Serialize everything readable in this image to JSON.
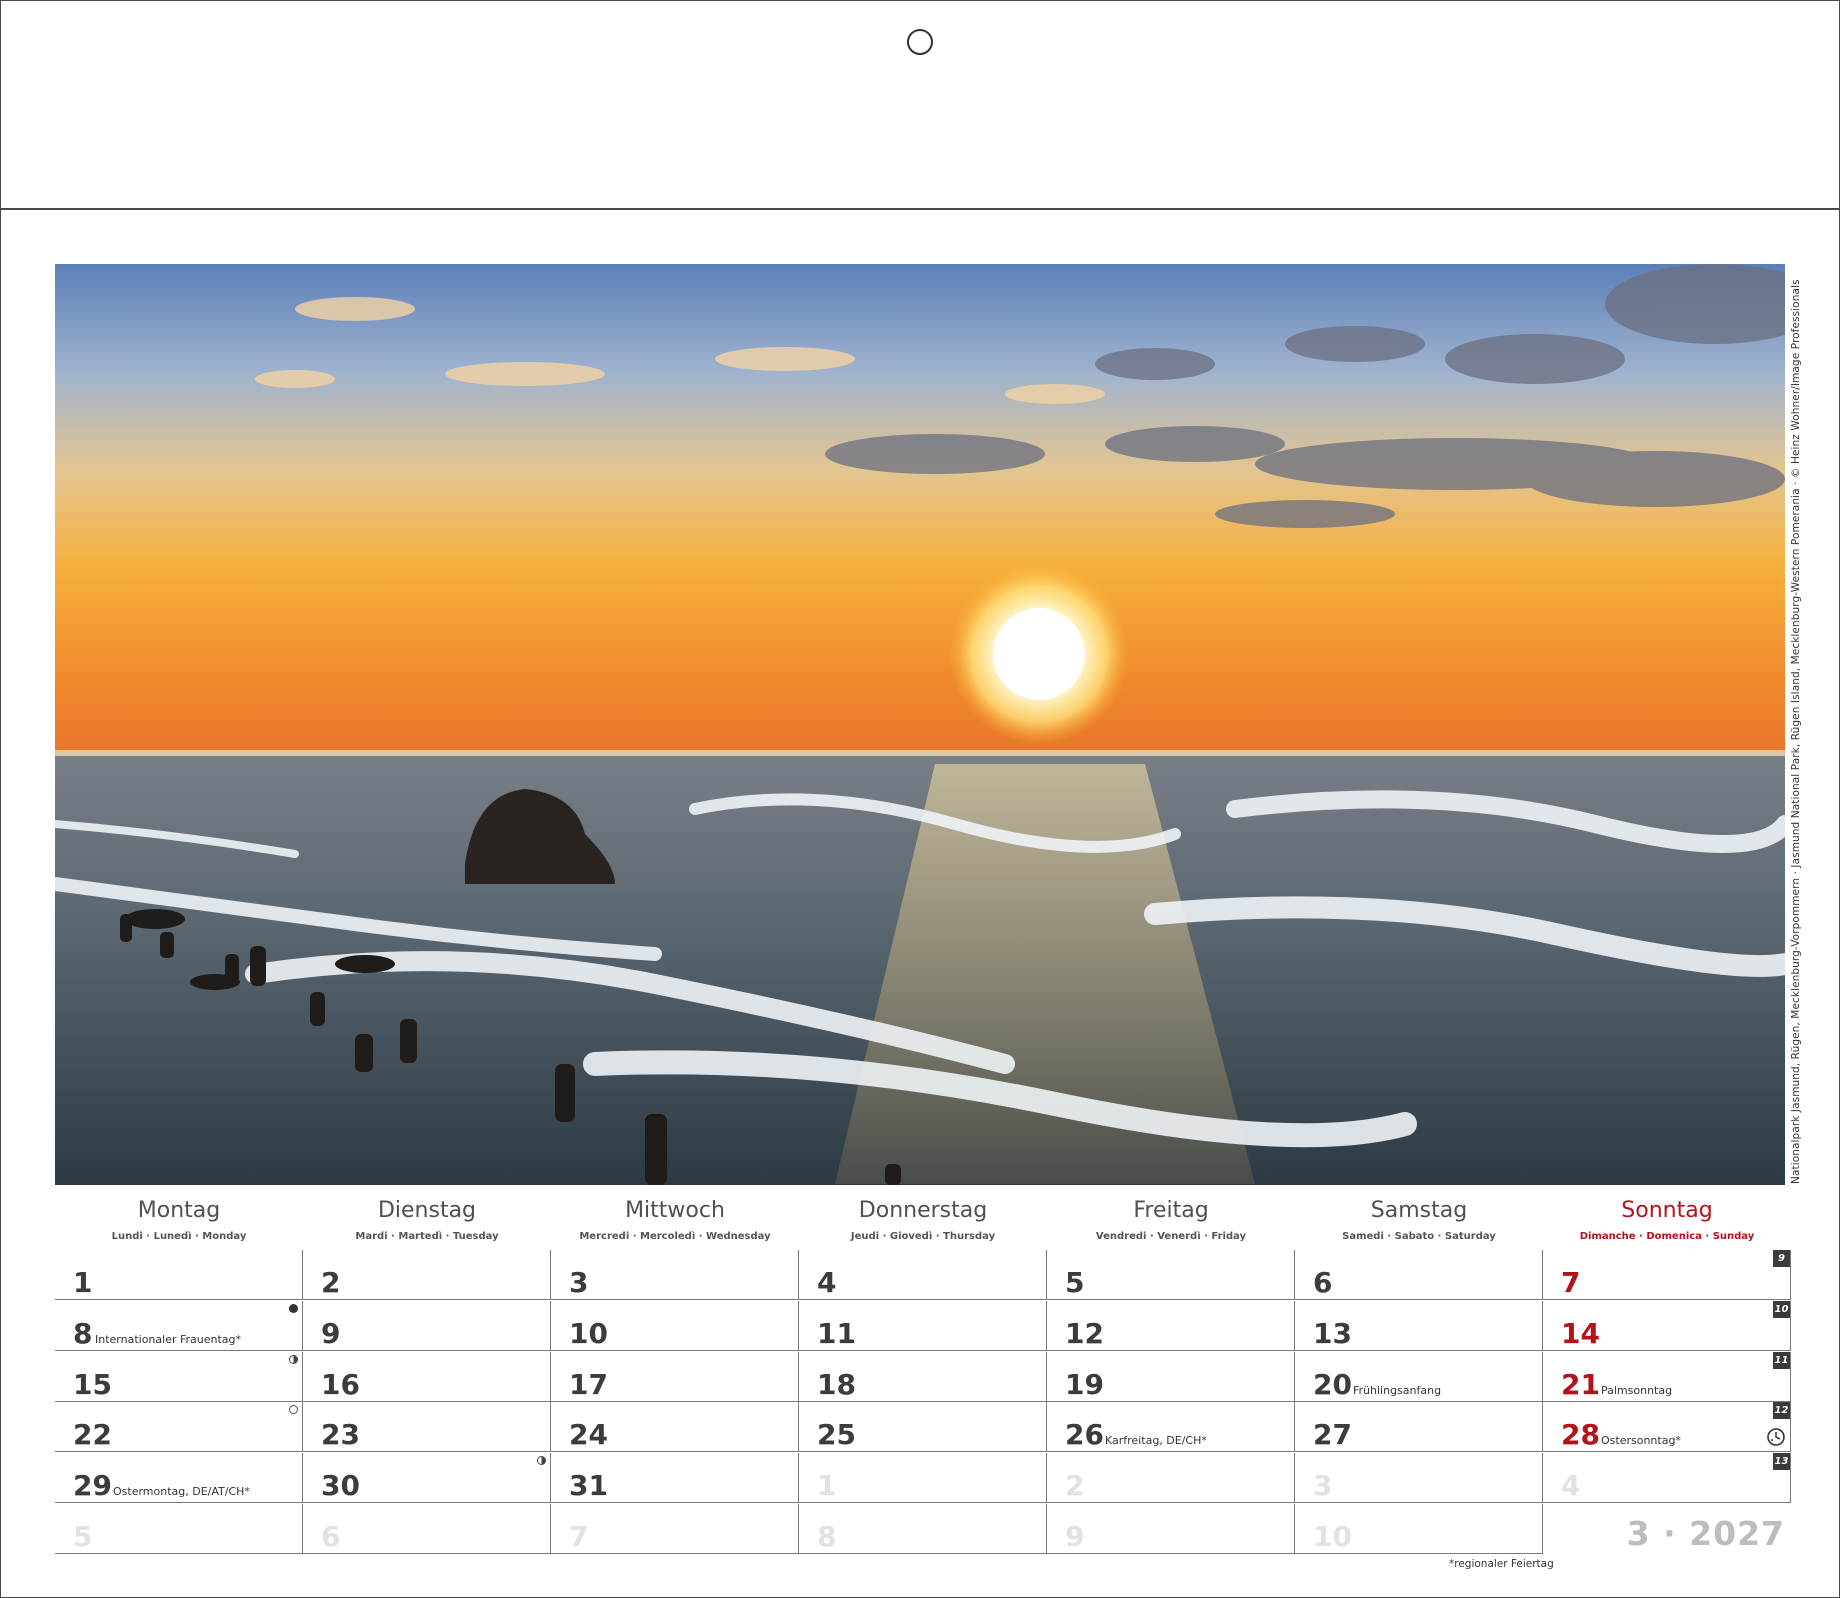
{
  "photo_credit": "Nationalpark Jasmund, Rügen, Mecklenburg-Vorpommern · Jasmund National Park, Rügen Island, Mecklenburg-Western Pomerania · © Heinz Wohner/Image Professionals",
  "weekdays": [
    {
      "name": "Montag",
      "sub": "Lundi · Lunedì · Monday"
    },
    {
      "name": "Dienstag",
      "sub": "Mardi · Martedì · Tuesday"
    },
    {
      "name": "Mittwoch",
      "sub": "Mercredi · Mercoledì · Wednesday"
    },
    {
      "name": "Donnerstag",
      "sub": "Jeudi · Giovedì · Thursday"
    },
    {
      "name": "Freitag",
      "sub": "Vendredi · Venerdì · Friday"
    },
    {
      "name": "Samstag",
      "sub": "Samedi · Sabato · Saturday"
    },
    {
      "name": "Sonntag",
      "sub": "Dimanche · Domenica · Sunday"
    }
  ],
  "weeks": [
    {
      "week_no": "9",
      "days": [
        {
          "n": "1"
        },
        {
          "n": "2"
        },
        {
          "n": "3"
        },
        {
          "n": "4"
        },
        {
          "n": "5"
        },
        {
          "n": "6"
        },
        {
          "n": "7"
        }
      ]
    },
    {
      "week_no": "10",
      "days": [
        {
          "n": "8",
          "note": "Internationaler Frauentag*",
          "moon": "new"
        },
        {
          "n": "9"
        },
        {
          "n": "10"
        },
        {
          "n": "11"
        },
        {
          "n": "12"
        },
        {
          "n": "13"
        },
        {
          "n": "14"
        }
      ]
    },
    {
      "week_no": "11",
      "days": [
        {
          "n": "15",
          "moon": "half"
        },
        {
          "n": "16"
        },
        {
          "n": "17"
        },
        {
          "n": "18"
        },
        {
          "n": "19"
        },
        {
          "n": "20",
          "note": "Frühlingsanfang"
        },
        {
          "n": "21",
          "note": "Palmsonntag"
        }
      ]
    },
    {
      "week_no": "12",
      "days": [
        {
          "n": "22",
          "moon": "full"
        },
        {
          "n": "23"
        },
        {
          "n": "24"
        },
        {
          "n": "25"
        },
        {
          "n": "26",
          "note": "Karfreitag, DE/CH*"
        },
        {
          "n": "27"
        },
        {
          "n": "28",
          "note": "Ostersonntag*",
          "icon": "daylight-saving-clock"
        }
      ]
    },
    {
      "week_no": "13",
      "days": [
        {
          "n": "29",
          "note": "Ostermontag, DE/AT/CH*"
        },
        {
          "n": "30",
          "moon": "half"
        },
        {
          "n": "31"
        },
        {
          "n": "1",
          "dim": true
        },
        {
          "n": "2",
          "dim": true
        },
        {
          "n": "3",
          "dim": true
        },
        {
          "n": "4",
          "dim": true
        }
      ]
    },
    {
      "days": [
        {
          "n": "5",
          "dim": true
        },
        {
          "n": "6",
          "dim": true
        },
        {
          "n": "7",
          "dim": true
        },
        {
          "n": "8",
          "dim": true
        },
        {
          "n": "9",
          "dim": true
        },
        {
          "n": "10",
          "dim": true
        }
      ]
    }
  ],
  "footnote": "*regionaler Feiertag",
  "month_year": "3 · 2027",
  "colors": {
    "sunday_red": "#b3121b",
    "grid_line": "#7a7a7a",
    "dim_number": "#e2e2e2"
  }
}
